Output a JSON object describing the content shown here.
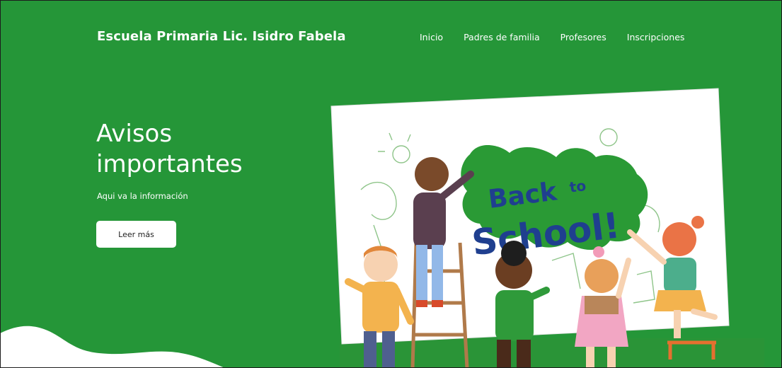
{
  "header": {
    "brand": "Escuela Primaria Lic. Isidro Fabela",
    "nav": [
      "Inicio",
      "Padres de familia",
      "Profesores",
      "Inscripciones"
    ]
  },
  "hero": {
    "title": "Avisos importantes",
    "subtitle": "Aqui va la información",
    "button_label": "Leer más"
  },
  "illustration": {
    "board_line1": "Back",
    "board_to": "to",
    "board_line2": "School!"
  },
  "colors": {
    "background": "#259638",
    "board": "#ffffff",
    "board_text": "#1f3f8f",
    "paint_green": "#2a9a35"
  }
}
